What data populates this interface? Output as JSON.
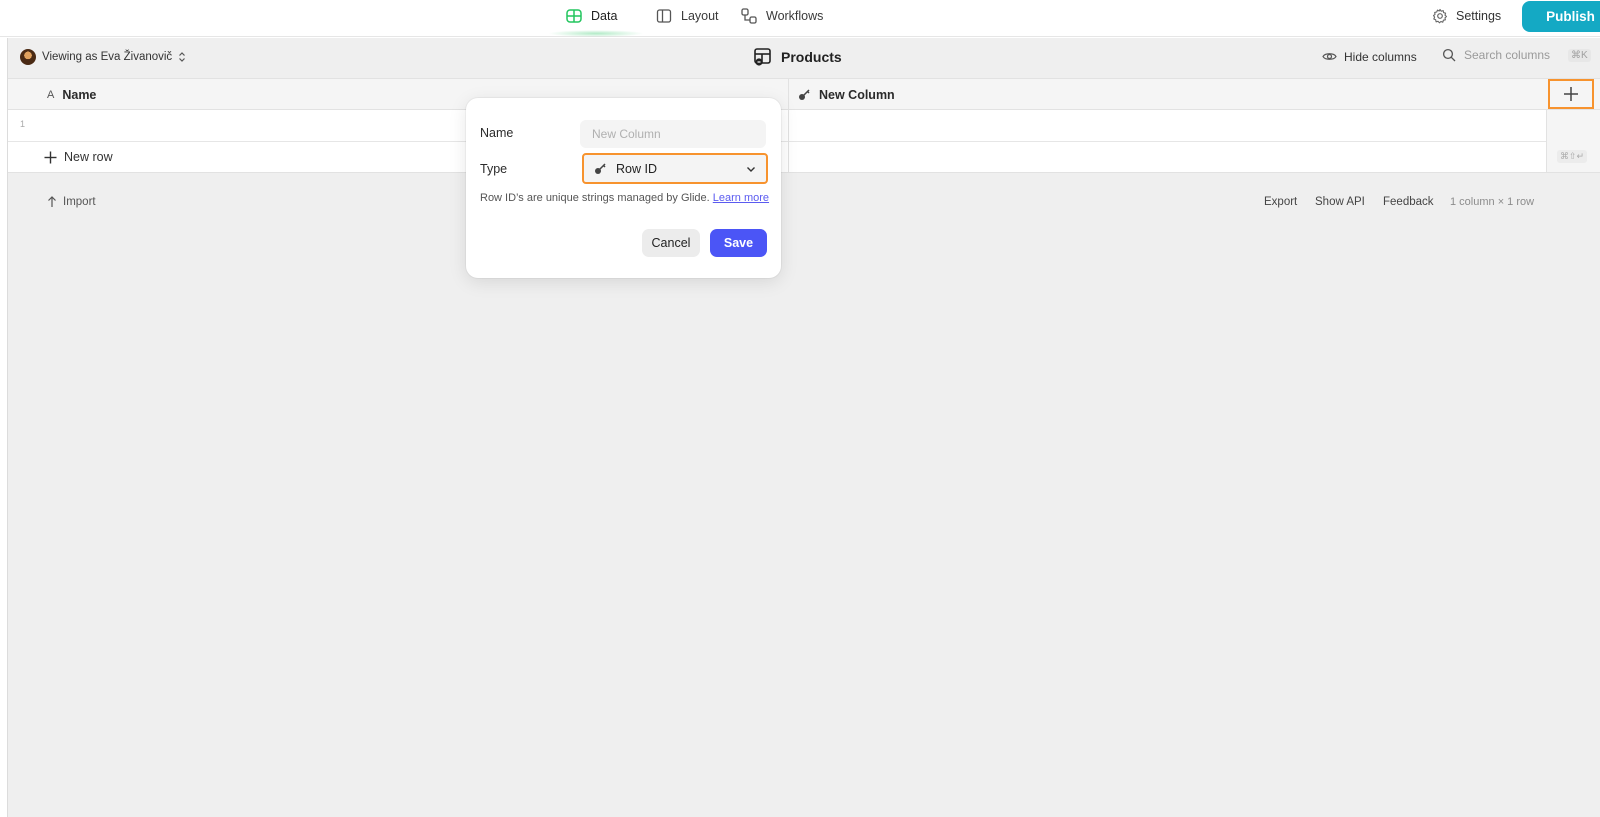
{
  "nav": {
    "tabs": [
      {
        "label": "Data",
        "icon": "table-icon",
        "active": true
      },
      {
        "label": "Layout",
        "icon": "layout-icon",
        "active": false
      },
      {
        "label": "Workflows",
        "icon": "workflows-icon",
        "active": false
      }
    ],
    "settings_label": "Settings",
    "publish_label": "Publish",
    "accent_color": "#14a9c4",
    "active_tab_color": "#22c55e"
  },
  "subbar": {
    "viewing_as": "Viewing as Eva Živanovič",
    "table_title": "Products",
    "hide_columns_label": "Hide columns",
    "search_placeholder": "Search columns",
    "search_shortcut": "⌘K"
  },
  "grid": {
    "columns": [
      {
        "label": "Name",
        "type_icon": "text-type-icon"
      },
      {
        "label": "New Column",
        "type_icon": "row-id-key-icon"
      }
    ],
    "rows": [
      {
        "number": "1"
      }
    ],
    "new_row_label": "New row",
    "new_row_shortcut": "⌘⇧↵",
    "highlight_color": "#f7932e"
  },
  "footer": {
    "import_label": "Import",
    "export_label": "Export",
    "show_api_label": "Show API",
    "feedback_label": "Feedback",
    "count_label": "1 column × 1 row"
  },
  "popover": {
    "name_label": "Name",
    "name_value": "",
    "name_placeholder": "New Column",
    "type_label": "Type",
    "type_value": "Row ID",
    "help_text": "Row ID’s are unique strings managed by Glide.",
    "help_link": "Learn more",
    "cancel_label": "Cancel",
    "save_label": "Save",
    "save_color": "#4b55f6"
  }
}
